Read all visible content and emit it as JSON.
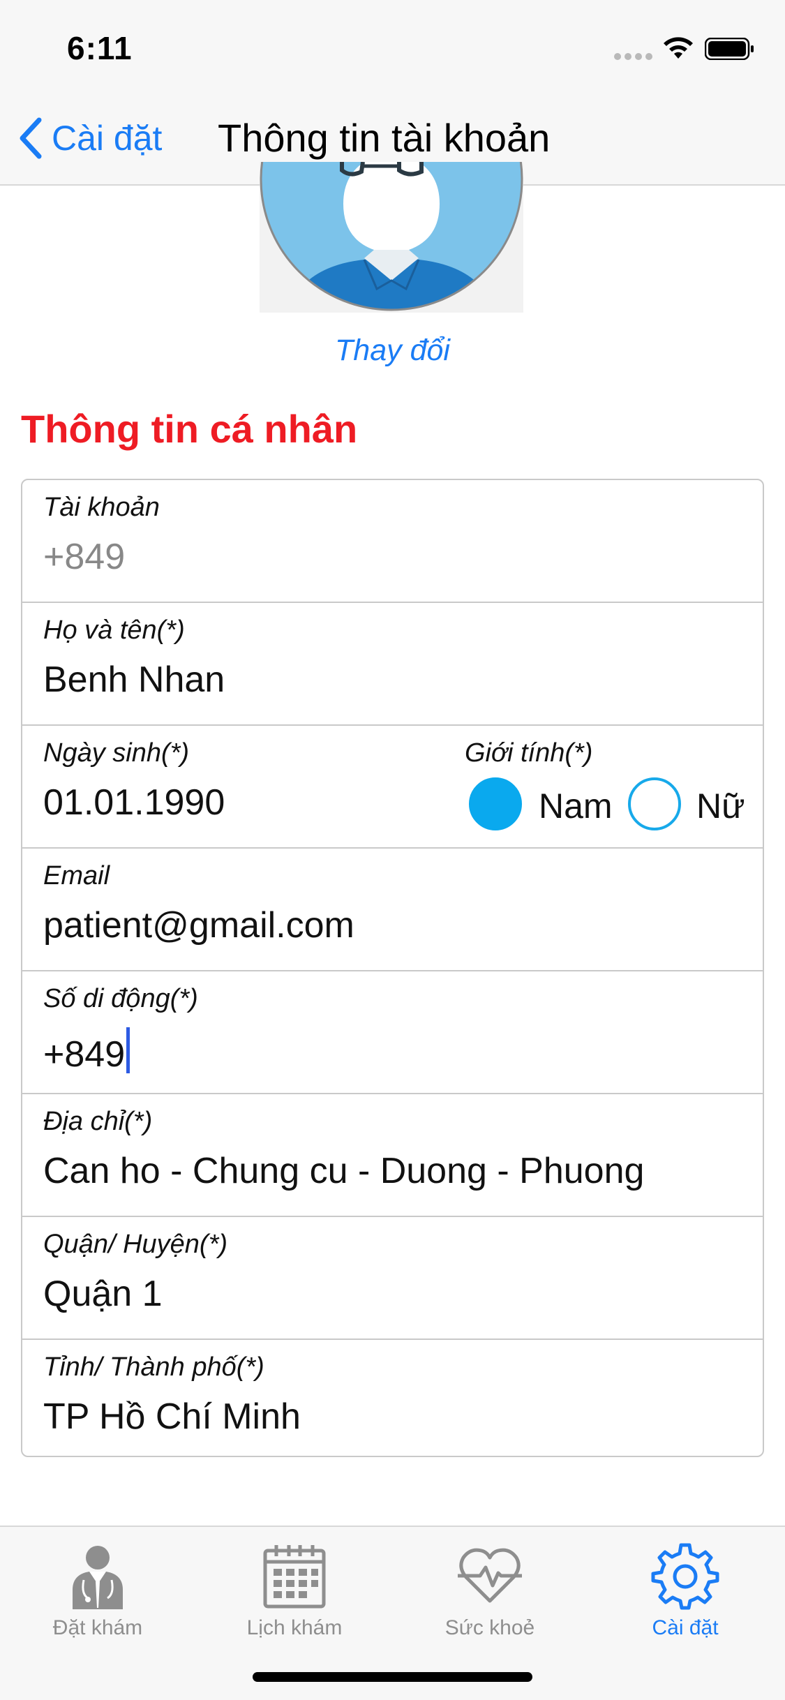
{
  "status_bar": {
    "time": "6:11"
  },
  "nav": {
    "back_label": "Cài đặt",
    "title": "Thông tin tài khoản"
  },
  "profile": {
    "change_photo_label": "Thay đổi"
  },
  "section": {
    "title": "Thông tin cá nhân"
  },
  "form": {
    "account": {
      "label": "Tài khoản",
      "value": "+849"
    },
    "full_name": {
      "label": "Họ và tên(*)",
      "value": "Benh Nhan"
    },
    "birth_date": {
      "label": "Ngày sinh(*)",
      "value": "01.01.1990"
    },
    "gender": {
      "label": "Giới tính(*)",
      "options": [
        {
          "label": "Nam",
          "selected": true
        },
        {
          "label": "Nữ",
          "selected": false
        }
      ]
    },
    "email": {
      "label": "Email",
      "value": "patient@gmail.com"
    },
    "phone": {
      "label": "Số di động(*)",
      "value": "+849"
    },
    "address": {
      "label": "Địa chỉ(*)",
      "value": "Can ho - Chung cu - Duong - Phuong"
    },
    "district": {
      "label": "Quận/ Huyện(*)",
      "value": "Quận 1"
    },
    "province": {
      "label": "Tỉnh/ Thành phố(*)",
      "value": "TP Hồ Chí Minh"
    }
  },
  "tab_bar": {
    "tabs": [
      {
        "label": "Đặt khám",
        "icon": "doctor-icon",
        "active": false
      },
      {
        "label": "Lịch khám",
        "icon": "calendar-icon",
        "active": false
      },
      {
        "label": "Sức khoẻ",
        "icon": "heart-pulse-icon",
        "active": false
      },
      {
        "label": "Cài đặt",
        "icon": "gear-icon",
        "active": true
      }
    ]
  },
  "colors": {
    "accent": "#1a7cf5",
    "section_title": "#ee1c24",
    "radio_selected": "#0aa9ee",
    "tab_inactive": "#8e8e8e"
  }
}
